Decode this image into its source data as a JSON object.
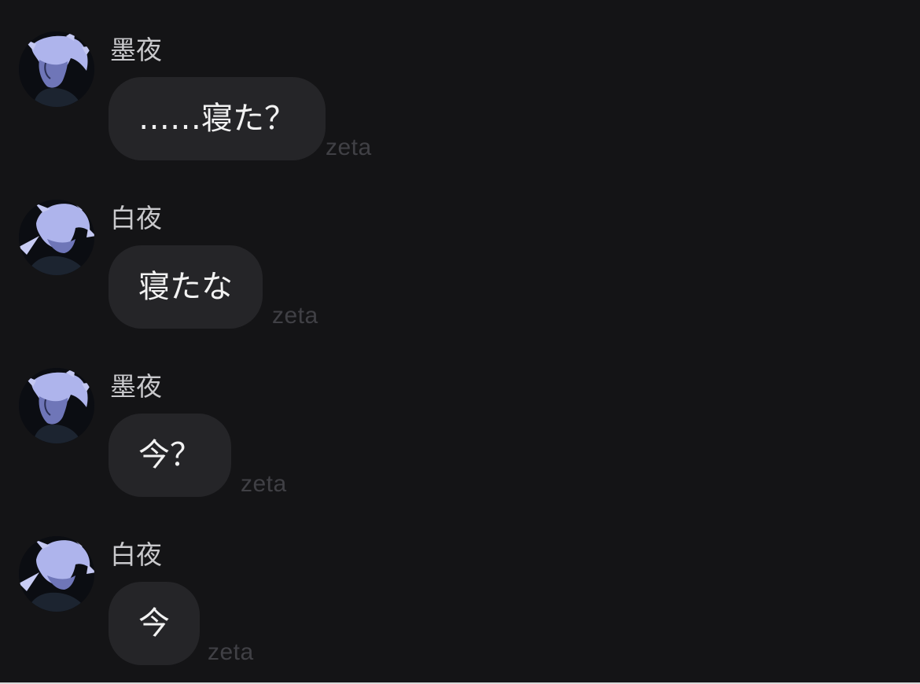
{
  "colors": {
    "background": "#141416",
    "bubble": "#252528",
    "sender_text": "#c9c9cc",
    "message_text": "#f2f2f2",
    "watermark": "#404045",
    "avatar_hair": "#aeb4ec"
  },
  "messages": [
    {
      "sender": "墨夜",
      "text": "……寝た？",
      "watermark": "zeta",
      "avatar_icon": "profile-left-avatar-icon"
    },
    {
      "sender": "白夜",
      "text": "寝たな",
      "watermark": "zeta",
      "avatar_icon": "head-down-avatar-icon"
    },
    {
      "sender": "墨夜",
      "text": "今？",
      "watermark": "zeta",
      "avatar_icon": "profile-left-avatar-icon"
    },
    {
      "sender": "白夜",
      "text": "今",
      "watermark": "zeta",
      "avatar_icon": "head-down-avatar-icon"
    }
  ]
}
